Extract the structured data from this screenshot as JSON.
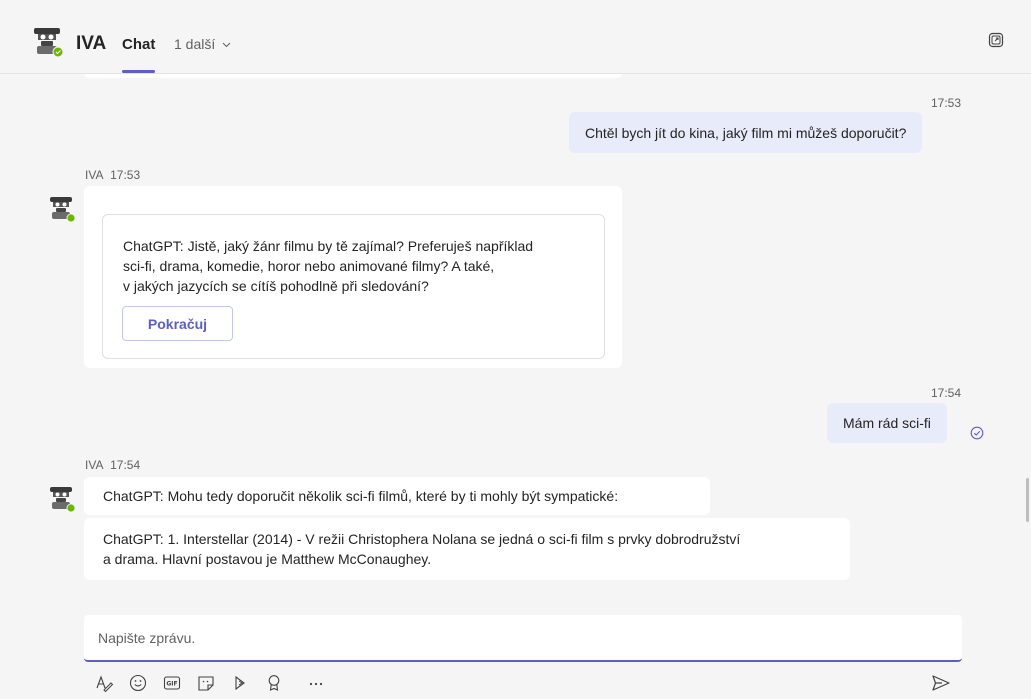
{
  "header": {
    "name": "IVA",
    "active_tab": "Chat",
    "more_tabs": "1 další",
    "icons": {
      "avatar": "robot-avatar",
      "presence": "available-badge",
      "chevron": "chevron-down-icon",
      "popout": "popout-icon"
    }
  },
  "messages": [
    {
      "type": "outgoing",
      "time": "17:53",
      "text": "Chtěl bych jít do kina, jaký film mi můžeš doporučit?"
    },
    {
      "type": "incoming",
      "sender": "IVA",
      "time": "17:53",
      "card": {
        "lines": [
          "ChatGPT: Jistě, jaký žánr filmu by tě zajímal? Preferuješ například",
          "sci-fi, drama, komedie, horor nebo animované filmy? A také,",
          "v jakých jazycích se cítíš pohodlně při sledování?"
        ],
        "button": "Pokračuj"
      }
    },
    {
      "type": "outgoing",
      "time": "17:54",
      "text": "Mám rád sci-fi",
      "status_icon": "read-check-icon"
    },
    {
      "type": "incoming",
      "sender": "IVA",
      "time": "17:54",
      "bubbles": [
        {
          "lines": [
            "ChatGPT: Mohu tedy doporučit několik sci-fi filmů, které by ti mohly být sympatické:"
          ]
        },
        {
          "lines": [
            "ChatGPT: 1. Interstellar (2014) - V režii Christophera Nolana se jedná o sci-fi film s prvky dobrodružství",
            "a drama. Hlavní postavou je Matthew McConaughey."
          ]
        }
      ]
    }
  ],
  "compose": {
    "placeholder": "Napište zprávu.",
    "toolbar": [
      "format-icon",
      "emoji-icon",
      "gif-icon",
      "sticker-icon",
      "loop-icon",
      "praise-icon",
      "more-options-icon"
    ],
    "send_icon": "send-icon"
  },
  "colors": {
    "accent": "#5b5fc7",
    "outgoing_bubble": "#e8ebfa",
    "background": "#f5f5f5",
    "presence": "#6bb700"
  }
}
